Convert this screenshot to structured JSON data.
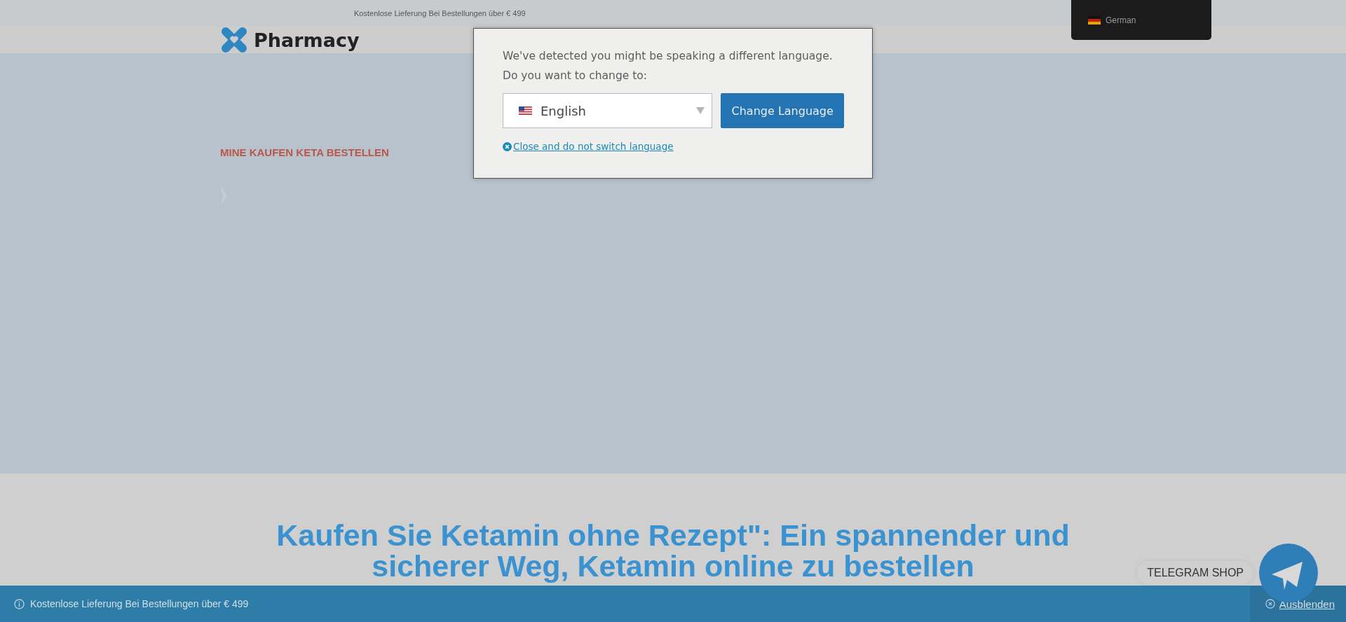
{
  "top_bar": {
    "text": "Kostenlose Lieferung Bei Bestellungen über € 499"
  },
  "header": {
    "logo_text": "Pharmacy"
  },
  "hero": {
    "breadcrumb": "MINE KAUFEN KETA BESTELLEN"
  },
  "heading": "Kaufen Sie Ketamin ohne Rezept\": Ein spannender und sicherer Weg, Ketamin online zu bestellen",
  "notice_bar": {
    "text": "Kostenlose Lieferung Bei Bestellungen über € 499",
    "dismiss": "Ausblenden"
  },
  "telegram": {
    "label": "TELEGRAM SHOP"
  },
  "language_switcher": {
    "current": "German"
  },
  "language_dialog": {
    "message": "We've detected you might be speaking a different language.",
    "question": "Do you want to change to:",
    "select_value": "English",
    "button": "Change Language",
    "close_link": "Close and do not switch language"
  }
}
